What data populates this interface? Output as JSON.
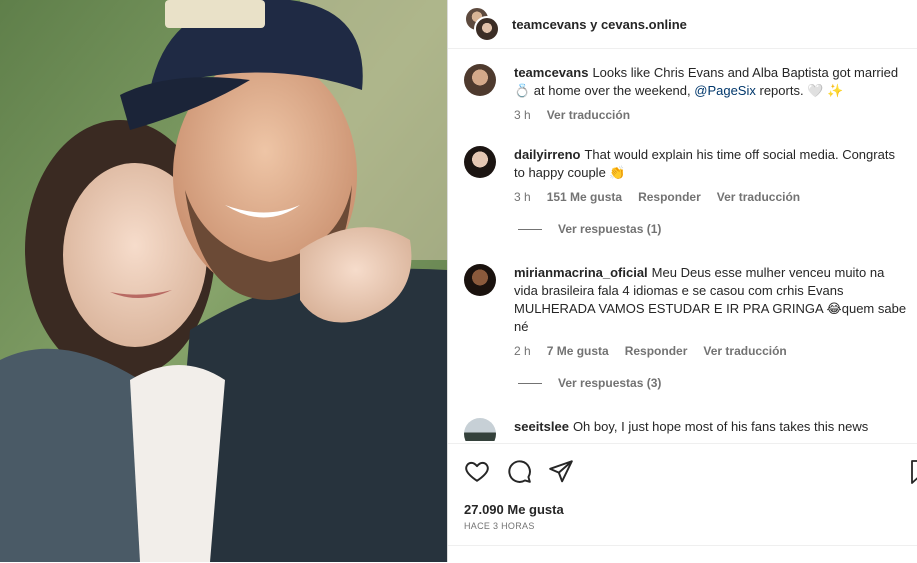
{
  "header": {
    "username": "teamcevans",
    "joiner": "y",
    "collaborator": "cevans.online"
  },
  "caption": {
    "username": "teamcevans",
    "text_part1": "Looks like Chris Evans and Alba Baptista got married 💍 at home over the weekend,",
    "mention": "@PageSix",
    "text_part2": "reports. 🤍 ✨",
    "time": "3 h",
    "translate": "Ver traducción"
  },
  "comments": [
    {
      "username": "dailyirreno",
      "text": "That would explain his time off social media. Congrats to happy couple 👏",
      "time": "3 h",
      "likes": "151 Me gusta",
      "reply": "Responder",
      "translate": "Ver traducción",
      "view_replies": "Ver respuestas (1)"
    },
    {
      "username": "mirianmacrina_oficial",
      "text": "Meu Deus esse mulher venceu muito na vida brasileira fala 4 idiomas e se casou com crhis Evans MULHERADA VAMOS ESTUDAR E IR PRA GRINGA 😂quem sabe né",
      "time": "2 h",
      "likes": "7 Me gusta",
      "reply": "Responder",
      "translate": "Ver traducción",
      "view_replies": "Ver respuestas (3)"
    },
    {
      "username": "seeitslee",
      "text": "Oh boy, I just hope most of his fans takes this news"
    }
  ],
  "actions": {
    "like_icon": "heart-icon",
    "comment_icon": "comment-icon",
    "share_icon": "send-icon",
    "save_icon": "bookmark-icon"
  },
  "likes_count": "27.090 Me gusta",
  "posted_ago": "HACE 3 HORAS"
}
